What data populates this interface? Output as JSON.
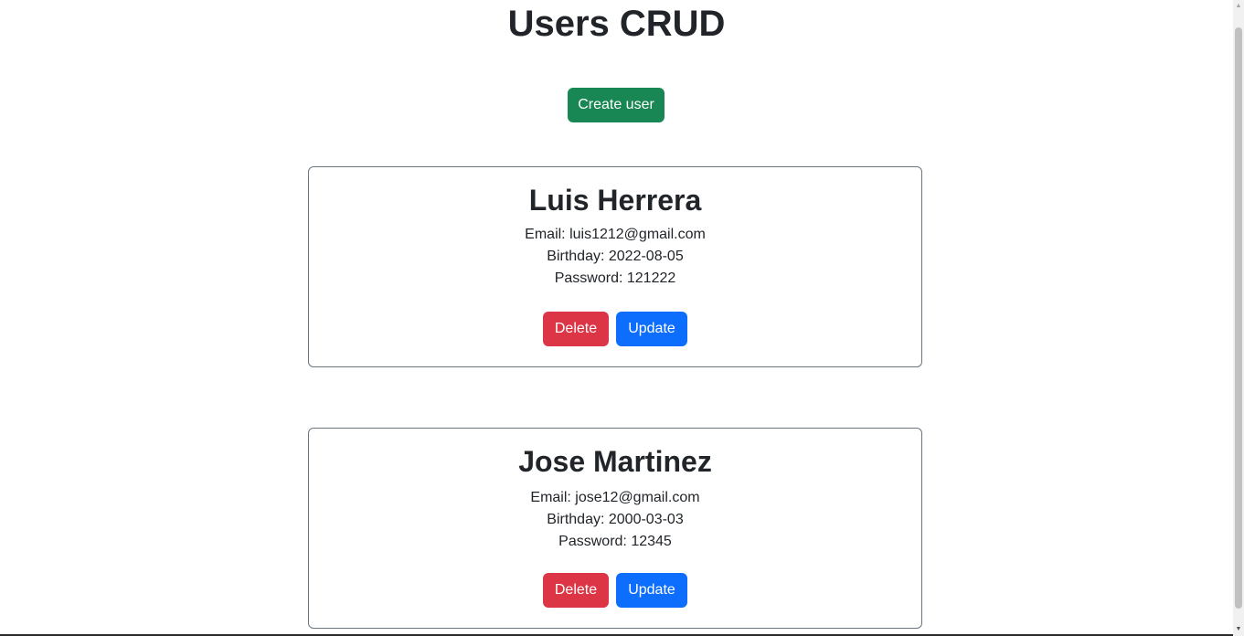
{
  "header": {
    "title": "Users CRUD",
    "create_label": "Create user"
  },
  "users": [
    {
      "name": "Luis Herrera",
      "email": "Email: luis1212@gmail.com",
      "birthday": "Birthday: 2022-08-05",
      "password": "Password: 121222",
      "delete_label": "Delete",
      "update_label": "Update"
    },
    {
      "name": "Jose Martinez",
      "email": "Email: jose12@gmail.com",
      "birthday": "Birthday: 2000-03-03",
      "password": "Password: 12345",
      "delete_label": "Delete",
      "update_label": "Update"
    }
  ],
  "colors": {
    "create": "#198754",
    "delete": "#dc3545",
    "update": "#0d6efd",
    "card_border": "#6c757d"
  },
  "scrollbar": {
    "up_icon": "scroll-up-arrow-icon",
    "down_icon": "scroll-down-arrow-icon"
  }
}
